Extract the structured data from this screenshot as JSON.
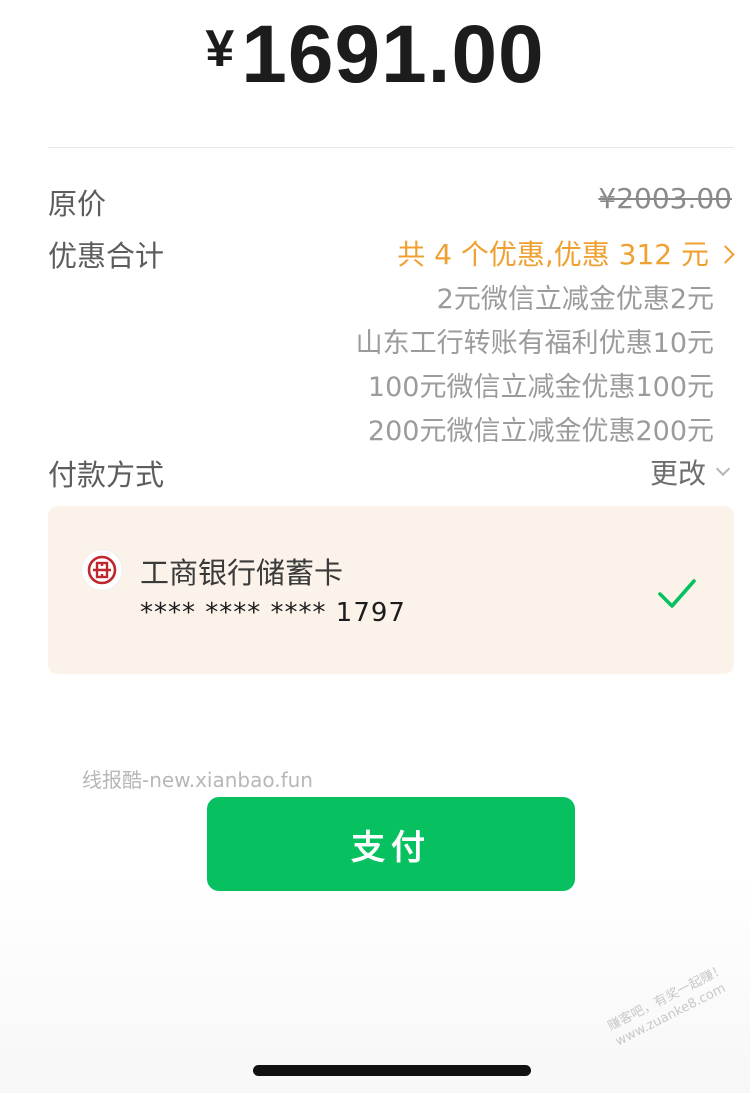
{
  "payment": {
    "currency": "¥",
    "amount": "1691.00"
  },
  "original_price": {
    "label": "原价",
    "value": "¥2003.00"
  },
  "discount": {
    "label": "优惠合计",
    "summary": "共 4 个优惠,优惠 312 元",
    "items": [
      "2元微信立减金优惠2元",
      "山东工行转账有福利优惠10元",
      "100元微信立减金优惠100元",
      "200元微信立减金优惠200元"
    ],
    "color": "#f0a030"
  },
  "payment_method": {
    "label": "付款方式",
    "change_label": "更改"
  },
  "card": {
    "bank_name": "工商银行储蓄卡",
    "number": "**** **** **** 1797",
    "background": "#fbf3ea",
    "bank_icon": "icbc-logo-icon",
    "check_icon": "checkmark-icon"
  },
  "pay_button": {
    "label": "支付",
    "color": "#07c160"
  },
  "watermark": "线报酷-new.xianbao.fun",
  "corner_watermark": {
    "line1": "赚客吧，有奖一起赚！",
    "line2": "www.zuanke8.com"
  }
}
